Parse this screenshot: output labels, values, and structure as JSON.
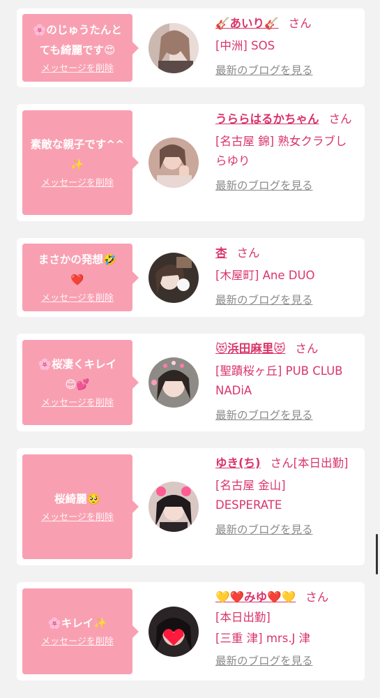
{
  "colors": {
    "accent": "#d9356a",
    "bubble": "#f8a0b2",
    "link_gray": "#8a8a8a"
  },
  "delete_label": "メッセージを削除",
  "blog_label": "最新のブログを見る",
  "san_label": "さん",
  "cards": [
    {
      "message": "🌸のじゅうたんとても綺麗です😍",
      "name": "🎸あいり🎸",
      "shop": "[中洲] SOS"
    },
    {
      "message": "素敵な親子です^^✨",
      "name": "うららはるかちゃん",
      "shop": "[名古屋 錦] 熟女クラブしらゆり"
    },
    {
      "message": "まさかの発想🤣❤️",
      "name": "杏",
      "shop": "[木屋町] Ane DUO"
    },
    {
      "message": "🌸桜凄くキレイ😊💕",
      "name": "😻浜田麻里😻",
      "shop": "[聖蹟桜ヶ丘] PUB CLUB NADiA"
    },
    {
      "message": "桜綺麗🥺",
      "name": "ゆき(ち)",
      "name_suffix": "[本日出勤]",
      "shop": "[名古屋 金山] DESPERATE"
    },
    {
      "message": "🌸キレイ✨",
      "name": "💛❤️みゆ❤️💛",
      "status": "[本日出勤]",
      "shop": "[三重 津] mrs.J 津"
    }
  ]
}
